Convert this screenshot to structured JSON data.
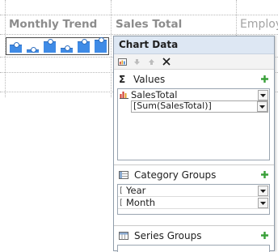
{
  "report": {
    "columns": {
      "trend": "Monthly Trend",
      "sales": "Sales Total",
      "employee": "Employ"
    },
    "sparkline": {
      "bar_values": [
        0.55,
        0.2,
        0.75,
        0.3,
        0.75,
        0.9
      ]
    }
  },
  "chart_data_panel": {
    "title": "Chart Data",
    "toolbar": {
      "properties_icon": "chart-properties-icon",
      "move_down_icon": "arrow-down-icon",
      "move_up_icon": "arrow-up-icon",
      "delete_icon": "delete-x-icon"
    },
    "values": {
      "label": "Values",
      "icon": "sigma-icon",
      "items": [
        {
          "name": "SalesTotal",
          "expression": "[Sum(SalesTotal)]"
        }
      ]
    },
    "category_groups": {
      "label": "Category Groups",
      "icon": "category-groups-icon",
      "items": [
        "Year",
        "Month"
      ]
    },
    "series_groups": {
      "label": "Series Groups",
      "icon": "series-groups-icon"
    },
    "colors": {
      "add_green": "#39a039",
      "header_bg": "#dde7f3",
      "bar_blue": "#3f8be6"
    }
  }
}
